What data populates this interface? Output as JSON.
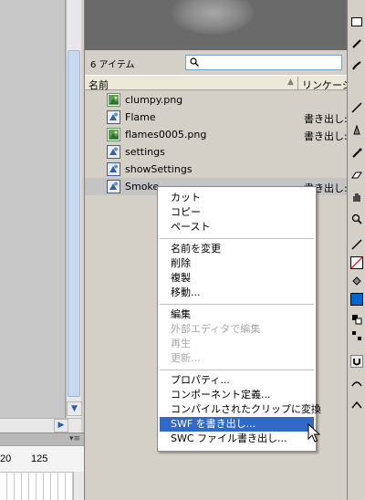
{
  "timeline": {
    "frame_numbers": [
      "20",
      "125"
    ]
  },
  "library": {
    "item_count_label": "6 アイテム",
    "search": {
      "value": "",
      "placeholder": ""
    },
    "columns": {
      "name": "名前",
      "linkage": "リンケージ"
    },
    "items": [
      {
        "name": "clumpy.png",
        "type": "bitmap",
        "linkage": ""
      },
      {
        "name": "Flame",
        "type": "movieclip",
        "linkage": "書き出し:"
      },
      {
        "name": "flames0005.png",
        "type": "bitmap",
        "linkage": "書き出し:"
      },
      {
        "name": "settings",
        "type": "movieclip",
        "linkage": ""
      },
      {
        "name": "showSettings",
        "type": "movieclip",
        "linkage": ""
      },
      {
        "name": "Smoke",
        "type": "movieclip",
        "linkage": "書き出し:",
        "selected": true
      }
    ]
  },
  "context_menu": {
    "groups": [
      [
        {
          "label": "カット",
          "enabled": true
        },
        {
          "label": "コピー",
          "enabled": true
        },
        {
          "label": "ペースト",
          "enabled": true
        }
      ],
      [
        {
          "label": "名前を変更",
          "enabled": true
        },
        {
          "label": "削除",
          "enabled": true
        },
        {
          "label": "複製",
          "enabled": true
        },
        {
          "label": "移動...",
          "enabled": true
        }
      ],
      [
        {
          "label": "編集",
          "enabled": true
        },
        {
          "label": "外部エディタで編集",
          "enabled": false
        },
        {
          "label": "再生",
          "enabled": false
        },
        {
          "label": "更新...",
          "enabled": false
        }
      ],
      [
        {
          "label": "プロパティ...",
          "enabled": true
        },
        {
          "label": "コンポーネント定義...",
          "enabled": true
        },
        {
          "label": "コンパイルされたクリップに変換",
          "enabled": true
        },
        {
          "label": "SWF を書き出し...",
          "enabled": true,
          "highlighted": true
        },
        {
          "label": "SWC ファイル書き出し...",
          "enabled": true
        }
      ]
    ]
  },
  "colors": {
    "menu_highlight": "#316ac5",
    "panel_bg": "#d4d0c8",
    "disabled_text": "#a8a8a8"
  },
  "tool_icons": [
    "rectangle-tool-icon",
    "pencil-tool-icon",
    "brush-tool-icon",
    "line-tool-icon",
    "eyedropper-tool-icon",
    "eraser-tool-icon",
    "hand-tool-icon",
    "zoom-tool-icon",
    "stroke-color-icon",
    "fill-color-icon",
    "swap-colors-icon",
    "snap-magnet-icon"
  ]
}
